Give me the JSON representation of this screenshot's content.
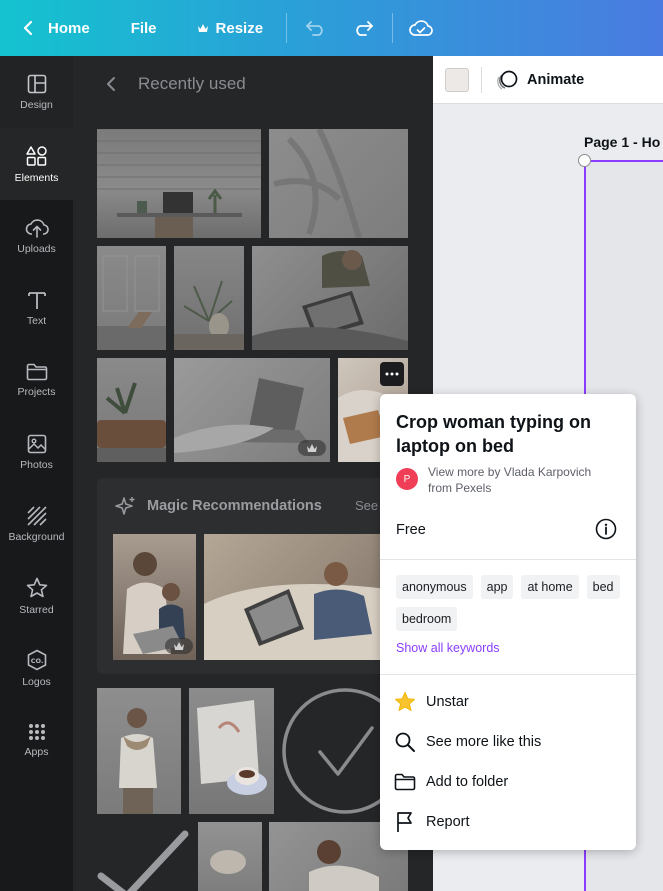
{
  "topbar": {
    "home_label": "Home",
    "file_label": "File",
    "resize_label": "Resize",
    "bg_start": "#14c3cf",
    "bg_end": "#4a7be0"
  },
  "rail": {
    "items": [
      {
        "label": "Design",
        "icon": "layout-icon"
      },
      {
        "label": "Elements",
        "icon": "shapes-icon"
      },
      {
        "label": "Uploads",
        "icon": "cloud-upload-icon"
      },
      {
        "label": "Text",
        "icon": "text-icon"
      },
      {
        "label": "Projects",
        "icon": "folder-icon"
      },
      {
        "label": "Photos",
        "icon": "image-icon"
      },
      {
        "label": "Background",
        "icon": "hatch-icon"
      },
      {
        "label": "Starred",
        "icon": "star-icon"
      },
      {
        "label": "Logos",
        "icon": "logo-icon"
      },
      {
        "label": "Apps",
        "icon": "apps-grid-icon"
      }
    ],
    "active": "Elements"
  },
  "panel": {
    "title": "Recently used",
    "magic_title": "Magic Recommendations",
    "magic_see_all": "See"
  },
  "canvas": {
    "animate_label": "Animate",
    "page_label": "Page 1 - Ho",
    "accent": "#8b3dff"
  },
  "popup": {
    "title": "Crop woman typing on laptop on bed",
    "author_initial": "P",
    "author_text": "View more by Vlada Karpovich from Pexels",
    "price": "Free",
    "tags": [
      "anonymous",
      "app",
      "at home",
      "bed",
      "bedroom"
    ],
    "show_all": "Show all keywords",
    "menu": {
      "unstar": "Unstar",
      "see_more": "See more like this",
      "add_folder": "Add to folder",
      "report": "Report"
    }
  }
}
